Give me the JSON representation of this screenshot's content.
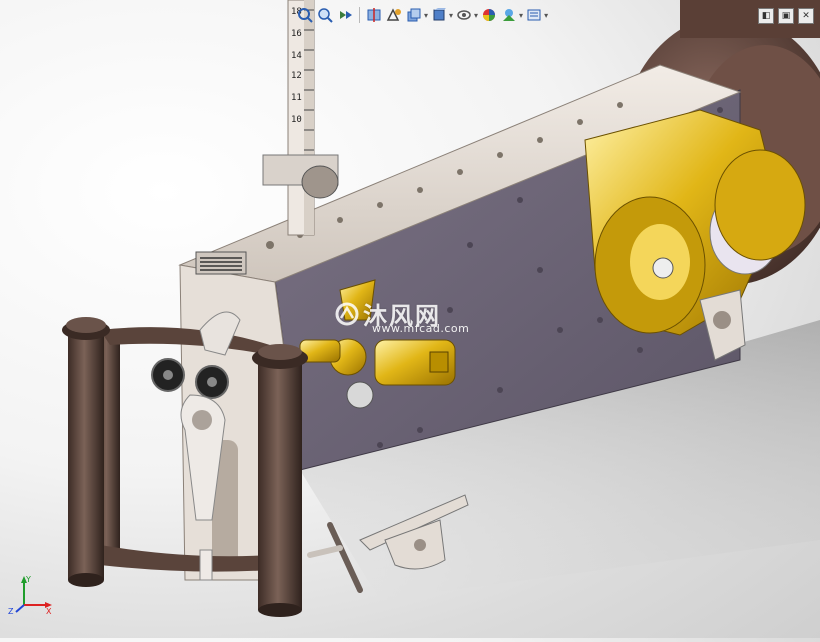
{
  "toolbar": {
    "items": [
      {
        "icon": "zoom-to-fit-icon"
      },
      {
        "icon": "zoom-area-icon"
      },
      {
        "icon": "previous-view-icon"
      },
      {
        "icon": "section-view-icon"
      },
      {
        "icon": "dynamic-annotation-icon"
      },
      {
        "icon": "view-orientation-icon"
      },
      {
        "icon": "display-style-icon"
      },
      {
        "icon": "hide-show-items-icon"
      },
      {
        "icon": "edit-appearance-icon"
      },
      {
        "icon": "apply-scene-icon"
      },
      {
        "icon": "view-settings-icon"
      }
    ]
  },
  "window": {
    "controls": [
      "◧",
      "▣",
      "✕"
    ]
  },
  "ruler": {
    "labels": [
      "18",
      "16",
      "14",
      "12",
      "11",
      "10"
    ]
  },
  "watermark": {
    "title": "沐风网",
    "url": "www.mfcad.com"
  },
  "triad": {
    "x": "X",
    "y": "Y",
    "z": "Z"
  },
  "colors": {
    "plate": "#6e6678",
    "brass": "#d4a80c",
    "bar": "#e9e2da",
    "handle": "#4e3b33",
    "disc": "#5c4038"
  }
}
